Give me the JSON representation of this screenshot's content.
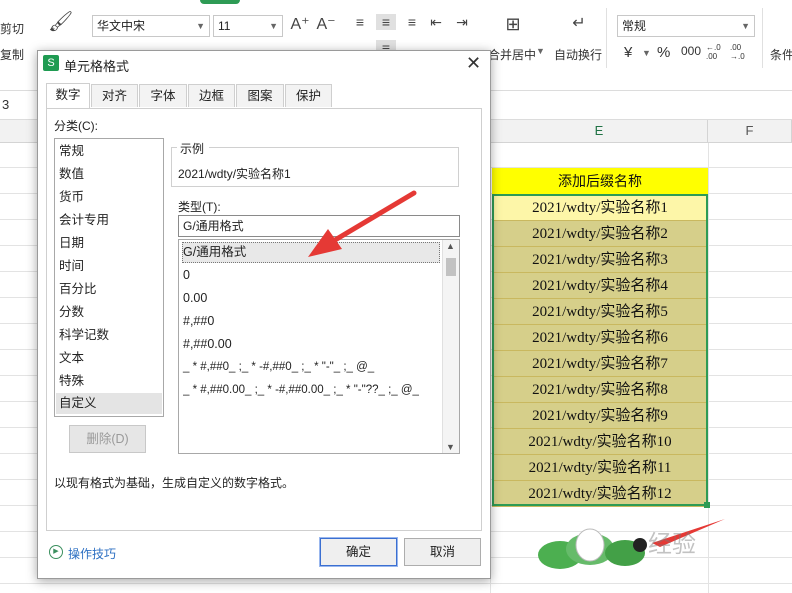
{
  "ribbon": {
    "cut": "剪切",
    "copy": "复制",
    "font_name": "华文中宋",
    "font_size": "11",
    "merge_center": "合并居中",
    "wrap_text": "自动换行",
    "number_format": "常规",
    "cond_format": "条件",
    "currency_symbol": "¥",
    "percent_symbol": "%",
    "thousands_symbol": "000",
    "dec_inc": "←.0 .00",
    "dec_dec": ".00 →.0"
  },
  "formula": {
    "cell_ref": "3"
  },
  "columns": {
    "e": "E",
    "f": "F"
  },
  "sheet": {
    "header": "添加后缀名称",
    "rows": [
      "2021/wdty/实验名称1",
      "2021/wdty/实验名称2",
      "2021/wdty/实验名称3",
      "2021/wdty/实验名称4",
      "2021/wdty/实验名称5",
      "2021/wdty/实验名称6",
      "2021/wdty/实验名称7",
      "2021/wdty/实验名称8",
      "2021/wdty/实验名称9",
      "2021/wdty/实验名称10",
      "2021/wdty/实验名称11",
      "2021/wdty/实验名称12"
    ]
  },
  "dialog": {
    "title": "单元格格式",
    "app_icon": "S",
    "tabs": [
      "数字",
      "对齐",
      "字体",
      "边框",
      "图案",
      "保护"
    ],
    "category_label": "分类(C):",
    "categories": [
      "常规",
      "数值",
      "货币",
      "会计专用",
      "日期",
      "时间",
      "百分比",
      "分数",
      "科学记数",
      "文本",
      "特殊",
      "自定义"
    ],
    "selected_category": "自定义",
    "sample_label": "示例",
    "sample_value": "2021/wdty/实验名称1",
    "type_label": "类型(T):",
    "type_value": "G/通用格式",
    "type_list": [
      "G/通用格式",
      "0",
      "0.00",
      "#,##0",
      "#,##0.00",
      "_ * #,##0_ ;_ * -#,##0_ ;_ * \"-\"_ ;_ @_",
      "_ * #,##0.00_ ;_ * -#,##0.00_ ;_ * \"-\"??_ ;_ @_"
    ],
    "delete_button": "删除(D)",
    "description": "以现有格式为基础，生成自定义的数字格式。",
    "tips_link": "操作技巧",
    "ok_button": "确定",
    "cancel_button": "取消"
  },
  "watermark": "经验",
  "colors": {
    "accent_green": "#217346",
    "selection_green": "#2e9b55",
    "header_yellow": "#ffff00",
    "cell_olive": "#d6cf8a",
    "arrow_red": "#e53935"
  }
}
